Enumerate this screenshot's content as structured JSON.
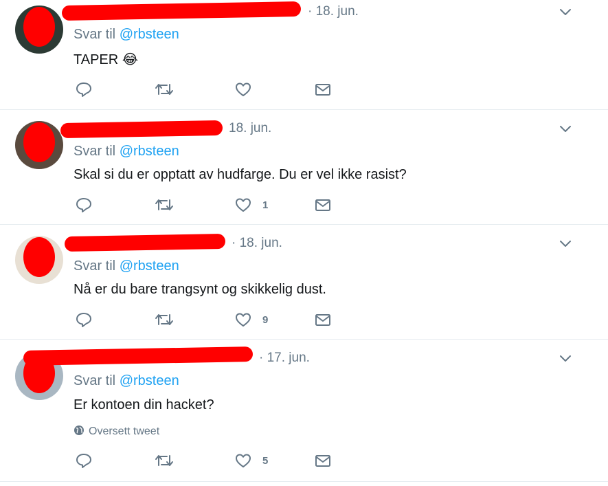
{
  "tweets": [
    {
      "date": "· 18. jun.",
      "reply_prefix": "Svar til ",
      "reply_handle": "@rbsteen",
      "text": "TAPER 😂",
      "likes": "",
      "translate": ""
    },
    {
      "date": "18. jun.",
      "reply_prefix": "Svar til ",
      "reply_handle": "@rbsteen",
      "text": "Skal si du er opptatt av hudfarge. Du er vel ikke rasist?",
      "likes": "1",
      "translate": ""
    },
    {
      "date": "· 18. jun.",
      "reply_prefix": "Svar til ",
      "reply_handle": "@rbsteen",
      "text": "Nå er du bare trangsynt og skikkelig dust.",
      "likes": "9",
      "translate": ""
    },
    {
      "date": "· 17. jun.",
      "reply_prefix": "Svar til ",
      "reply_handle": "@rbsteen",
      "text": "Er kontoen din hacket?",
      "likes": "5",
      "translate": "Oversett tweet"
    }
  ],
  "icons": {
    "reply": "reply-icon",
    "retweet": "retweet-icon",
    "like": "heart-icon",
    "dm": "envelope-icon",
    "more": "chevron-down-icon",
    "globe": "globe-icon"
  },
  "colors": {
    "link": "#1da1f2",
    "muted": "#657786",
    "text": "#14171a",
    "redaction": "#ff0000",
    "divider": "#e6ecf0"
  }
}
